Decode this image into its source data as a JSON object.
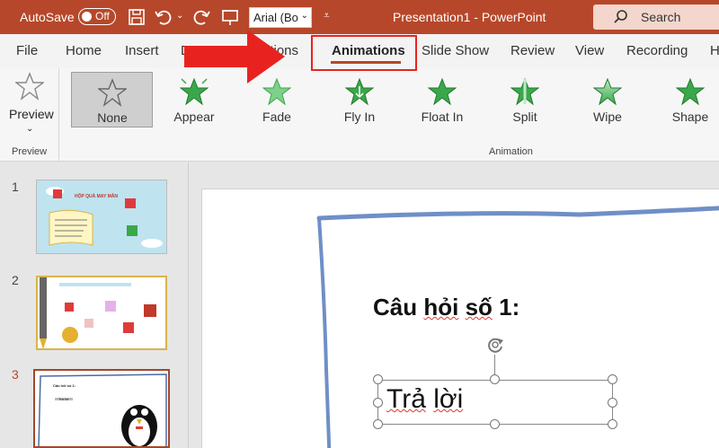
{
  "titlebar": {
    "autosave_label": "AutoSave",
    "toggle_state": "Off",
    "font_name": "Arial (Bo",
    "doc_title": "Presentation1  -  PowerPoint",
    "search_label": "Search"
  },
  "menu": {
    "tabs": [
      "File",
      "Home",
      "Insert",
      "D",
      "itions",
      "Animations",
      "Slide Show",
      "Review",
      "View",
      "Recording",
      "H"
    ]
  },
  "ribbon": {
    "preview_label": "Preview",
    "preview_group_label": "Preview",
    "animation_group_label": "Animation",
    "animations": [
      "None",
      "Appear",
      "Fade",
      "Fly In",
      "Float In",
      "Split",
      "Wipe",
      "Shape"
    ]
  },
  "thumbnails": {
    "numbers": [
      "1",
      "2",
      "3"
    ],
    "t1_title": "HỘP QUÀ MAY MẮN",
    "t3_title": "Câu hỏi số 1:",
    "t3_answer": "Trả lời"
  },
  "slide": {
    "question_prefix": "Câu ",
    "question_word": "hỏi",
    "question_mid": " ",
    "question_word2": "số",
    "question_suffix": " 1:",
    "answer_word1": "Trả",
    "answer_word2": "lời"
  },
  "colors": {
    "accent": "#b7472a",
    "highlight": "#e8231f",
    "star_green": "#3aa84a"
  }
}
